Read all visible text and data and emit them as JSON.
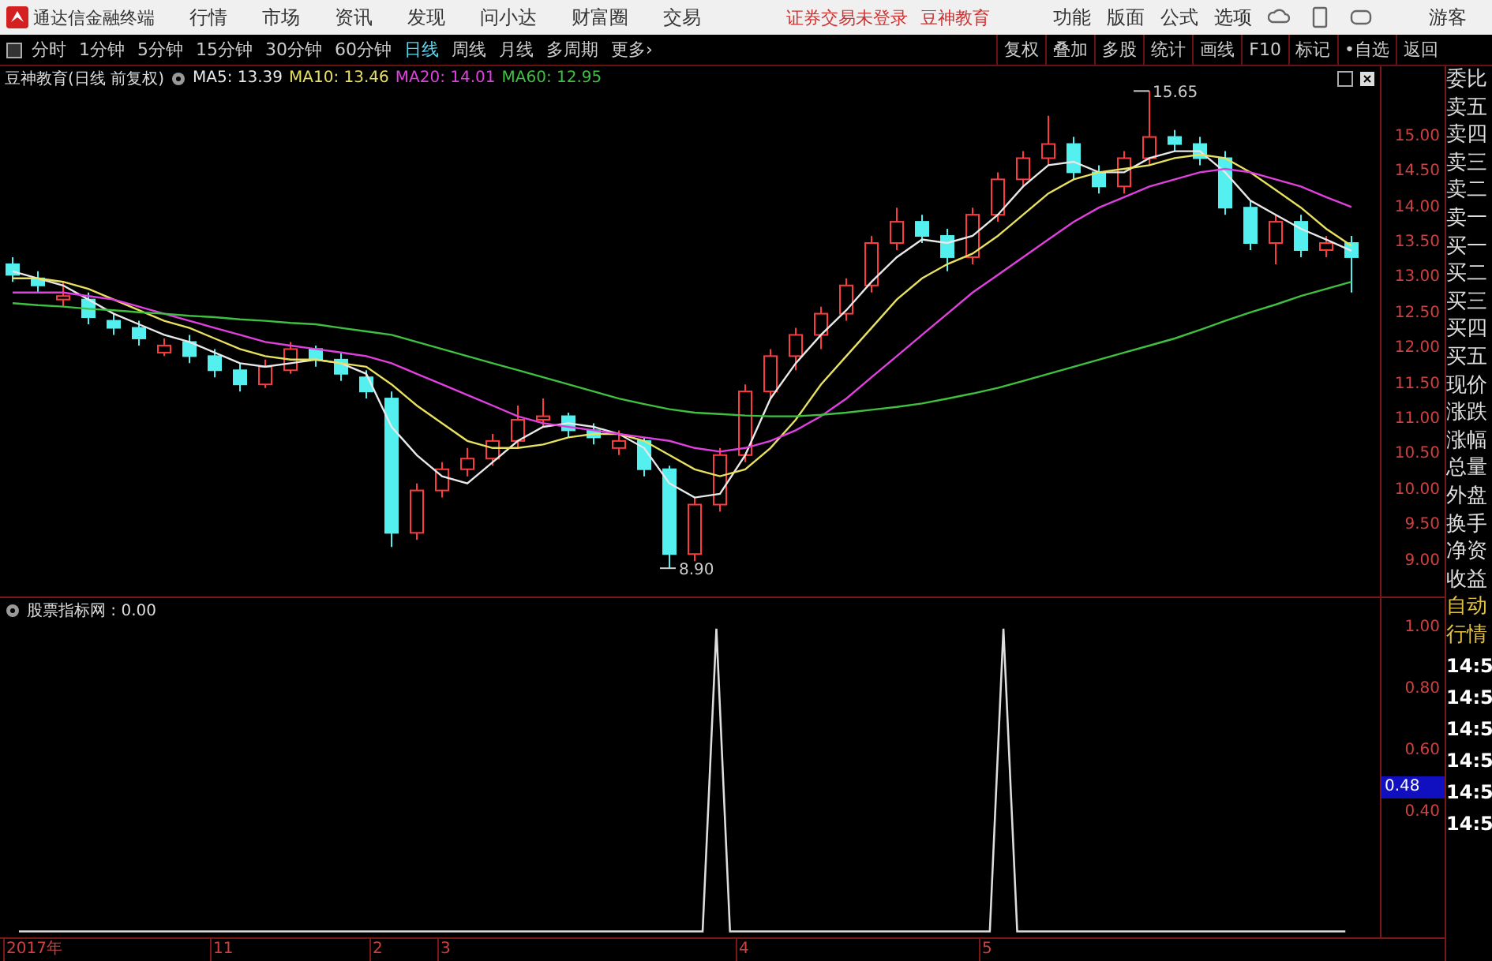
{
  "app_bar": {
    "title": "通达信金融终端",
    "menu": [
      "行情",
      "市场",
      "资讯",
      "发现",
      "问小达",
      "财富圈",
      "交易"
    ],
    "notices": [
      "证券交易未登录",
      "豆神教育"
    ],
    "right_menu": [
      "功能",
      "版面",
      "公式",
      "选项"
    ],
    "user": "游客"
  },
  "toolbar": {
    "periods": [
      {
        "label": "分时",
        "selected": false
      },
      {
        "label": "1分钟",
        "selected": false
      },
      {
        "label": "5分钟",
        "selected": false
      },
      {
        "label": "15分钟",
        "selected": false
      },
      {
        "label": "30分钟",
        "selected": false
      },
      {
        "label": "60分钟",
        "selected": false
      },
      {
        "label": "日线",
        "selected": true
      },
      {
        "label": "周线",
        "selected": false
      },
      {
        "label": "月线",
        "selected": false
      },
      {
        "label": "多周期",
        "selected": false
      },
      {
        "label": "更多›",
        "selected": false
      }
    ],
    "buttons": [
      "复权",
      "叠加",
      "多股",
      "统计",
      "画线",
      "F10",
      "标记",
      "•自选",
      "返回"
    ]
  },
  "price_chart": {
    "title": "豆神教育(日线 前复权)",
    "chart_data": {
      "type": "candlestick",
      "ylim": [
        8.5,
        16
      ],
      "yticks": [
        {
          "value": 15,
          "label": "15.00"
        },
        {
          "value": 14.5,
          "label": "14.50"
        },
        {
          "value": 14,
          "label": "14.00"
        },
        {
          "value": 13.5,
          "label": "13.50"
        },
        {
          "value": 13,
          "label": "13.00"
        },
        {
          "value": 12.5,
          "label": "12.50"
        },
        {
          "value": 12,
          "label": "12.00"
        },
        {
          "value": 11.5,
          "label": "11.50"
        },
        {
          "value": 11,
          "label": "11.00"
        },
        {
          "value": 10.5,
          "label": "10.50"
        },
        {
          "value": 10,
          "label": "10.00"
        },
        {
          "value": 9.5,
          "label": "9.50"
        },
        {
          "value": 9,
          "label": "9.00"
        }
      ],
      "ohlc": [
        [
          13.2,
          13.3,
          12.95,
          13.05
        ],
        [
          13.0,
          13.1,
          12.8,
          12.9
        ],
        [
          12.7,
          12.95,
          12.6,
          12.75
        ],
        [
          12.7,
          12.8,
          12.35,
          12.45
        ],
        [
          12.4,
          12.5,
          12.2,
          12.3
        ],
        [
          12.3,
          12.4,
          12.05,
          12.15
        ],
        [
          11.95,
          12.15,
          11.9,
          12.05
        ],
        [
          12.1,
          12.2,
          11.8,
          11.9
        ],
        [
          11.9,
          12.0,
          11.6,
          11.7
        ],
        [
          11.7,
          11.8,
          11.4,
          11.5
        ],
        [
          11.5,
          11.85,
          11.45,
          11.75
        ],
        [
          11.7,
          12.1,
          11.65,
          12.0
        ],
        [
          12.0,
          12.05,
          11.75,
          11.85
        ],
        [
          11.85,
          11.95,
          11.55,
          11.65
        ],
        [
          11.6,
          11.7,
          11.3,
          11.4
        ],
        [
          11.3,
          11.4,
          9.2,
          9.4
        ],
        [
          9.4,
          10.1,
          9.3,
          10.0
        ],
        [
          10.0,
          10.4,
          9.9,
          10.3
        ],
        [
          10.3,
          10.6,
          10.2,
          10.45
        ],
        [
          10.45,
          10.8,
          10.35,
          10.7
        ],
        [
          10.7,
          11.2,
          10.6,
          11.0
        ],
        [
          11.0,
          11.3,
          10.9,
          11.05
        ],
        [
          11.05,
          11.1,
          10.75,
          10.85
        ],
        [
          10.85,
          10.95,
          10.65,
          10.75
        ],
        [
          10.6,
          10.85,
          10.5,
          10.7
        ],
        [
          10.7,
          10.75,
          10.2,
          10.3
        ],
        [
          10.3,
          10.35,
          8.9,
          9.1
        ],
        [
          9.1,
          9.9,
          9.0,
          9.8
        ],
        [
          9.8,
          10.6,
          9.7,
          10.5
        ],
        [
          10.5,
          11.5,
          10.4,
          11.4
        ],
        [
          11.4,
          12.0,
          11.3,
          11.9
        ],
        [
          11.9,
          12.3,
          11.7,
          12.2
        ],
        [
          12.2,
          12.6,
          12.0,
          12.5
        ],
        [
          12.5,
          13.0,
          12.4,
          12.9
        ],
        [
          12.9,
          13.6,
          12.8,
          13.5
        ],
        [
          13.5,
          14.0,
          13.4,
          13.8
        ],
        [
          13.8,
          13.9,
          13.5,
          13.6
        ],
        [
          13.6,
          13.7,
          13.1,
          13.3
        ],
        [
          13.3,
          14.0,
          13.2,
          13.9
        ],
        [
          13.9,
          14.5,
          13.8,
          14.4
        ],
        [
          14.4,
          14.8,
          14.3,
          14.7
        ],
        [
          14.7,
          15.3,
          14.6,
          14.9
        ],
        [
          14.9,
          15.0,
          14.4,
          14.5
        ],
        [
          14.5,
          14.6,
          14.2,
          14.3
        ],
        [
          14.3,
          14.8,
          14.2,
          14.7
        ],
        [
          14.7,
          15.65,
          14.6,
          15.0
        ],
        [
          15.0,
          15.1,
          14.8,
          14.9
        ],
        [
          14.9,
          15.0,
          14.6,
          14.7
        ],
        [
          14.7,
          14.8,
          13.9,
          14.0
        ],
        [
          14.0,
          14.1,
          13.4,
          13.5
        ],
        [
          13.5,
          13.9,
          13.2,
          13.8
        ],
        [
          13.8,
          13.9,
          13.3,
          13.4
        ],
        [
          13.4,
          13.6,
          13.3,
          13.5
        ],
        [
          13.5,
          13.6,
          12.8,
          13.3
        ]
      ],
      "series": [
        {
          "name": "MA5: 13.39",
          "type": "line",
          "color": "#e8e8e8",
          "values": [
            13.1,
            13.0,
            12.9,
            12.7,
            12.5,
            12.35,
            12.2,
            12.1,
            11.95,
            11.8,
            11.75,
            11.8,
            11.85,
            11.8,
            11.65,
            10.9,
            10.5,
            10.2,
            10.1,
            10.4,
            10.7,
            10.9,
            10.95,
            10.9,
            10.8,
            10.6,
            10.1,
            9.9,
            9.95,
            10.5,
            11.3,
            11.8,
            12.2,
            12.55,
            12.95,
            13.3,
            13.55,
            13.5,
            13.6,
            13.9,
            14.3,
            14.6,
            14.65,
            14.5,
            14.5,
            14.7,
            14.8,
            14.8,
            14.5,
            14.1,
            13.9,
            13.7,
            13.55,
            13.39
          ]
        },
        {
          "name": "MA10: 13.46",
          "type": "line",
          "color": "#e8e060",
          "values": [
            13.0,
            13.0,
            12.95,
            12.85,
            12.7,
            12.55,
            12.4,
            12.3,
            12.15,
            12.0,
            11.9,
            11.85,
            11.85,
            11.8,
            11.75,
            11.5,
            11.2,
            10.95,
            10.7,
            10.6,
            10.6,
            10.65,
            10.75,
            10.8,
            10.8,
            10.7,
            10.5,
            10.3,
            10.2,
            10.3,
            10.6,
            11.0,
            11.5,
            11.9,
            12.3,
            12.7,
            13.0,
            13.2,
            13.35,
            13.6,
            13.9,
            14.2,
            14.4,
            14.5,
            14.55,
            14.6,
            14.7,
            14.75,
            14.7,
            14.5,
            14.25,
            14.0,
            13.7,
            13.46
          ]
        },
        {
          "name": "MA20: 14.01",
          "type": "line",
          "color": "#e040e0",
          "values": [
            12.8,
            12.8,
            12.8,
            12.75,
            12.7,
            12.6,
            12.5,
            12.4,
            12.3,
            12.2,
            12.1,
            12.05,
            12.0,
            11.95,
            11.9,
            11.8,
            11.65,
            11.5,
            11.35,
            11.2,
            11.05,
            10.95,
            10.9,
            10.85,
            10.8,
            10.75,
            10.7,
            10.6,
            10.55,
            10.6,
            10.7,
            10.85,
            11.05,
            11.3,
            11.6,
            11.9,
            12.2,
            12.5,
            12.8,
            13.05,
            13.3,
            13.55,
            13.8,
            14.0,
            14.15,
            14.3,
            14.4,
            14.5,
            14.55,
            14.5,
            14.4,
            14.3,
            14.15,
            14.01
          ]
        },
        {
          "name": "MA60: 12.95",
          "type": "line",
          "color": "#40c040",
          "values": [
            12.65,
            12.62,
            12.6,
            12.57,
            12.55,
            12.52,
            12.5,
            12.47,
            12.45,
            12.42,
            12.4,
            12.37,
            12.35,
            12.3,
            12.25,
            12.2,
            12.1,
            12.0,
            11.9,
            11.8,
            11.7,
            11.6,
            11.5,
            11.4,
            11.3,
            11.22,
            11.15,
            11.1,
            11.08,
            11.06,
            11.05,
            11.05,
            11.07,
            11.1,
            11.14,
            11.18,
            11.23,
            11.3,
            11.37,
            11.45,
            11.55,
            11.65,
            11.75,
            11.85,
            11.95,
            12.05,
            12.15,
            12.27,
            12.4,
            12.52,
            12.63,
            12.75,
            12.85,
            12.95
          ]
        }
      ]
    },
    "high_marker": "15.65",
    "low_marker": "8.90"
  },
  "indicator": {
    "title": "股票指标网 : 0.00",
    "current_value": "0.48",
    "chart_data": {
      "type": "line",
      "ylim": [
        -0.02,
        1.1
      ],
      "yticks": [
        {
          "value": 1,
          "label": "1.00"
        },
        {
          "value": 0.8,
          "label": "0.80"
        },
        {
          "value": 0.6,
          "label": "0.60"
        },
        {
          "value": 0.4,
          "label": "0.40"
        }
      ],
      "series": [
        {
          "values": [
            0,
            0,
            0,
            0,
            0,
            0,
            0,
            0,
            0,
            0,
            0,
            0,
            0,
            0,
            0,
            0,
            0,
            0,
            0,
            0,
            0,
            0,
            0,
            0,
            0,
            0,
            0,
            0,
            0,
            0,
            0,
            0,
            0,
            0,
            0,
            0,
            0,
            0,
            0,
            0,
            0,
            0,
            0,
            0,
            0,
            0,
            0,
            0,
            0,
            0,
            0,
            1,
            0,
            0,
            0,
            0,
            0,
            0,
            0,
            0,
            0,
            0,
            0,
            0,
            0,
            0,
            0,
            0,
            0,
            0,
            0,
            0,
            1,
            0,
            0,
            0,
            0,
            0,
            0,
            0,
            0,
            0,
            0,
            0,
            0,
            0,
            0,
            0,
            0,
            0,
            0,
            0,
            0,
            0,
            0,
            0,
            0,
            0
          ]
        }
      ]
    }
  },
  "date_axis": [
    "2017年",
    "11",
    "2",
    "3",
    "4",
    "5"
  ],
  "quote_panel": {
    "fields": [
      "委比",
      "卖五",
      "卖四",
      "卖三",
      "卖二",
      "卖一",
      "买一",
      "买二",
      "买三",
      "买四",
      "买五",
      "现价",
      "涨跌",
      "涨幅",
      "总量",
      "外盘",
      "换手",
      "净资",
      "收益"
    ],
    "tabs": [
      "自动",
      "行情"
    ],
    "times": [
      "14:5",
      "14:5",
      "14:5",
      "14:5",
      "14:5",
      "14:5"
    ]
  }
}
